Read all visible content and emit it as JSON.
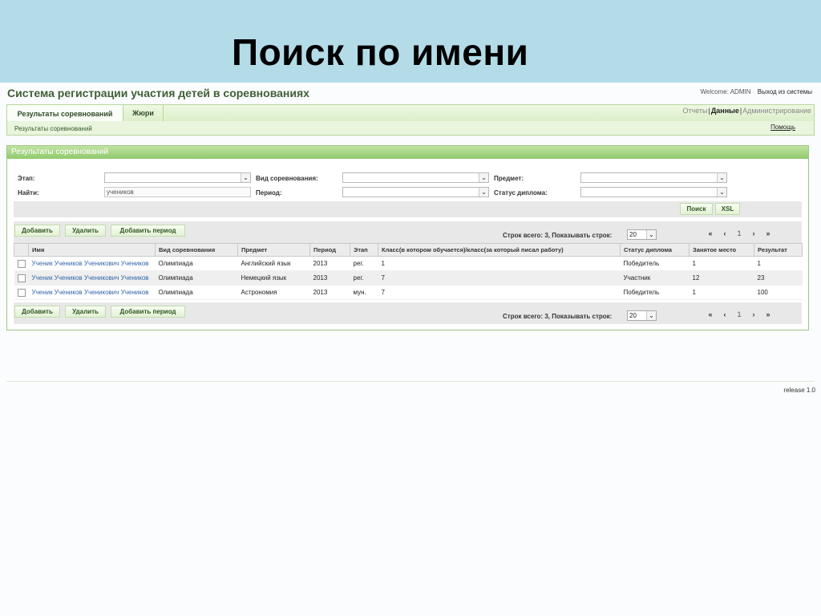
{
  "slide": {
    "title": "Поиск по имени"
  },
  "app": {
    "title": "Система регистрации участия детей в соревнованиях",
    "welcome": "Welcome: ADMIN",
    "logout": "Выход из системы"
  },
  "nav": {
    "tabs": [
      "Результаты соревнований",
      "Жюри"
    ],
    "links": [
      "Отчеты",
      "Данные",
      "Администрирование"
    ],
    "active_link": "Данные",
    "breadcrumb": "Результаты соревнований",
    "help": "Помощь"
  },
  "panel": {
    "title": "Результаты соревнований"
  },
  "filters": {
    "stage_label": "Этап:",
    "competition_type_label": "Вид соревнования:",
    "subject_label": "Предмет:",
    "find_label": "Найти:",
    "find_value": "учеников",
    "period_label": "Период:",
    "diploma_status_label": "Статус диплома:"
  },
  "actions": {
    "search": "Поиск",
    "export": "XSL"
  },
  "toolbar": {
    "add": "Добавить",
    "delete": "Удалить",
    "add_period": "Добавить период",
    "rows_info": "Строк всего: 3, Показывать строк:",
    "page_size": "20"
  },
  "pager": {
    "first": "«",
    "prev": "‹",
    "page": "1",
    "next": "›",
    "last": "»"
  },
  "table": {
    "columns": [
      "Имя",
      "Вид соревнования",
      "Предмет",
      "Период",
      "Этап",
      "Класс(в котором обучается)/класс(за который писал работу)",
      "Статус диплома",
      "Занятое место",
      "Результат"
    ],
    "rows": [
      [
        "Ученик Учеников Ученикович Учеников",
        "Олимпиада",
        "Английский язык",
        "2013",
        "рег.",
        "1",
        "Победитель",
        "1",
        "1"
      ],
      [
        "Ученик Учеников Ученикович Учеников",
        "Олимпиада",
        "Немецкий язык",
        "2013",
        "рег.",
        "7",
        "Участник",
        "12",
        "23"
      ],
      [
        "Ученик Учеников Ученикович Учеников",
        "Олимпиада",
        "Астрономия",
        "2013",
        "мун.",
        "7",
        "Победитель",
        "1",
        "100"
      ]
    ]
  },
  "footer": {
    "release": "release 1.0"
  }
}
